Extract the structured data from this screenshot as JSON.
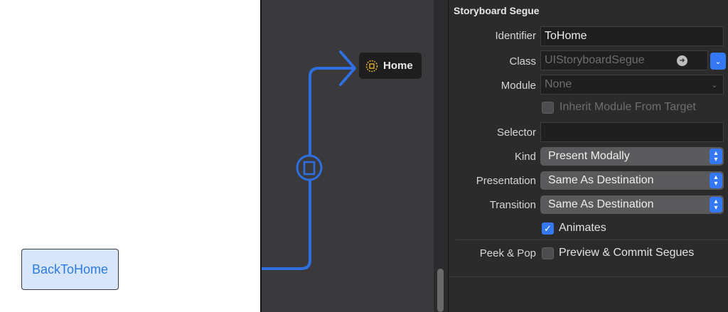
{
  "scene": {
    "back_button_label": "BackToHome"
  },
  "canvas": {
    "destination_label": "Home"
  },
  "inspector": {
    "section_title": "Storyboard Segue",
    "identifier": {
      "label": "Identifier",
      "value": "ToHome"
    },
    "class": {
      "label": "Class",
      "placeholder": "UIStoryboardSegue"
    },
    "module": {
      "label": "Module",
      "placeholder": "None"
    },
    "inherit_module": {
      "label": "Inherit Module From Target",
      "checked": false
    },
    "selector": {
      "label": "Selector",
      "value": ""
    },
    "kind": {
      "label": "Kind",
      "value": "Present Modally"
    },
    "presentation": {
      "label": "Presentation",
      "value": "Same As Destination"
    },
    "transition": {
      "label": "Transition",
      "value": "Same As Destination"
    },
    "animates": {
      "label": "Animates",
      "checked": true
    },
    "peek_pop": {
      "label": "Peek & Pop",
      "option_label": "Preview & Commit Segues",
      "checked": false
    }
  },
  "colors": {
    "accent": "#3478f6",
    "segue_line": "#2f6fe0",
    "scene_button_bg": "#d7e6fc"
  }
}
